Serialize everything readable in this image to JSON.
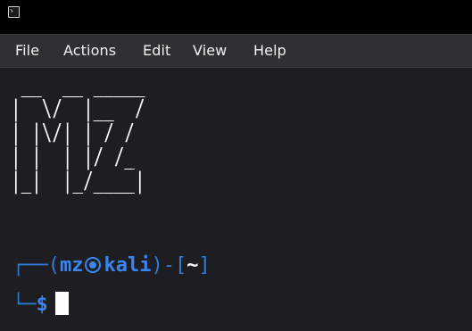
{
  "titlebar": {
    "icon": "terminal-icon"
  },
  "menubar": {
    "items": [
      {
        "label": "File"
      },
      {
        "label": "Actions"
      },
      {
        "label": "Edit"
      },
      {
        "label": "View"
      },
      {
        "label": "Help"
      }
    ]
  },
  "terminal": {
    "banner_lines": [
      " __  __ _____",
      "|  \\/  |__  /",
      "| |\\/| | / / ",
      "| |  | |/ /_ ",
      "|_|  |_/____|"
    ],
    "prompt": {
      "frame_top": "┌──(",
      "user": "mz",
      "symbol": "skull-icon",
      "host": "kali",
      "sep": ")-[",
      "cwd": "~",
      "close": "]",
      "frame_bottom": "└─",
      "dollar": "$"
    },
    "colors": {
      "background": "#1e1e22",
      "prompt_blue": "#3a86f0",
      "menubar": "#2f3032"
    }
  }
}
